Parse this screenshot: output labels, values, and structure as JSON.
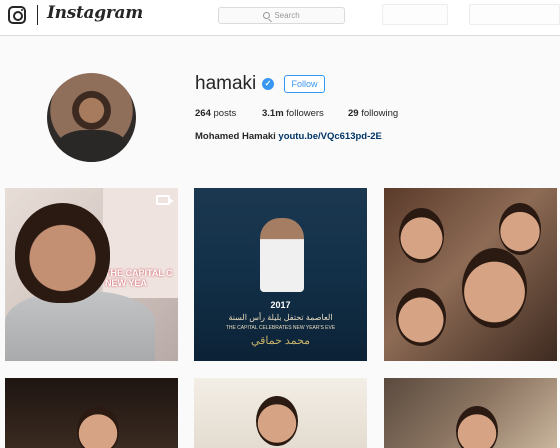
{
  "app": {
    "name": "Instagram",
    "search_placeholder": "Search"
  },
  "profile": {
    "username": "hamaki",
    "follow_label": "Follow",
    "posts_count": "264",
    "posts_label": "posts",
    "followers_count": "3.1m",
    "followers_label": "followers",
    "following_count": "29",
    "following_label": "following",
    "full_name": "Mohamed Hamaki",
    "link": "youtu.be/VQc613pd-2E"
  },
  "posts": [
    {
      "poster_text": "THE CAPITAL C NEW YEA"
    },
    {
      "year": "2017",
      "arabic_line": "العاصمة تحتفل بليلة رأس السنة",
      "subtitle": "THE CAPITAL CELEBRATES NEW YEAR'S EVE",
      "name_arabic": "محمد حماقي"
    },
    {},
    {},
    {},
    {}
  ],
  "colors": {
    "accent": "#3897f0",
    "link": "#003569",
    "border": "#dbdbdb",
    "background": "#fafafa"
  }
}
